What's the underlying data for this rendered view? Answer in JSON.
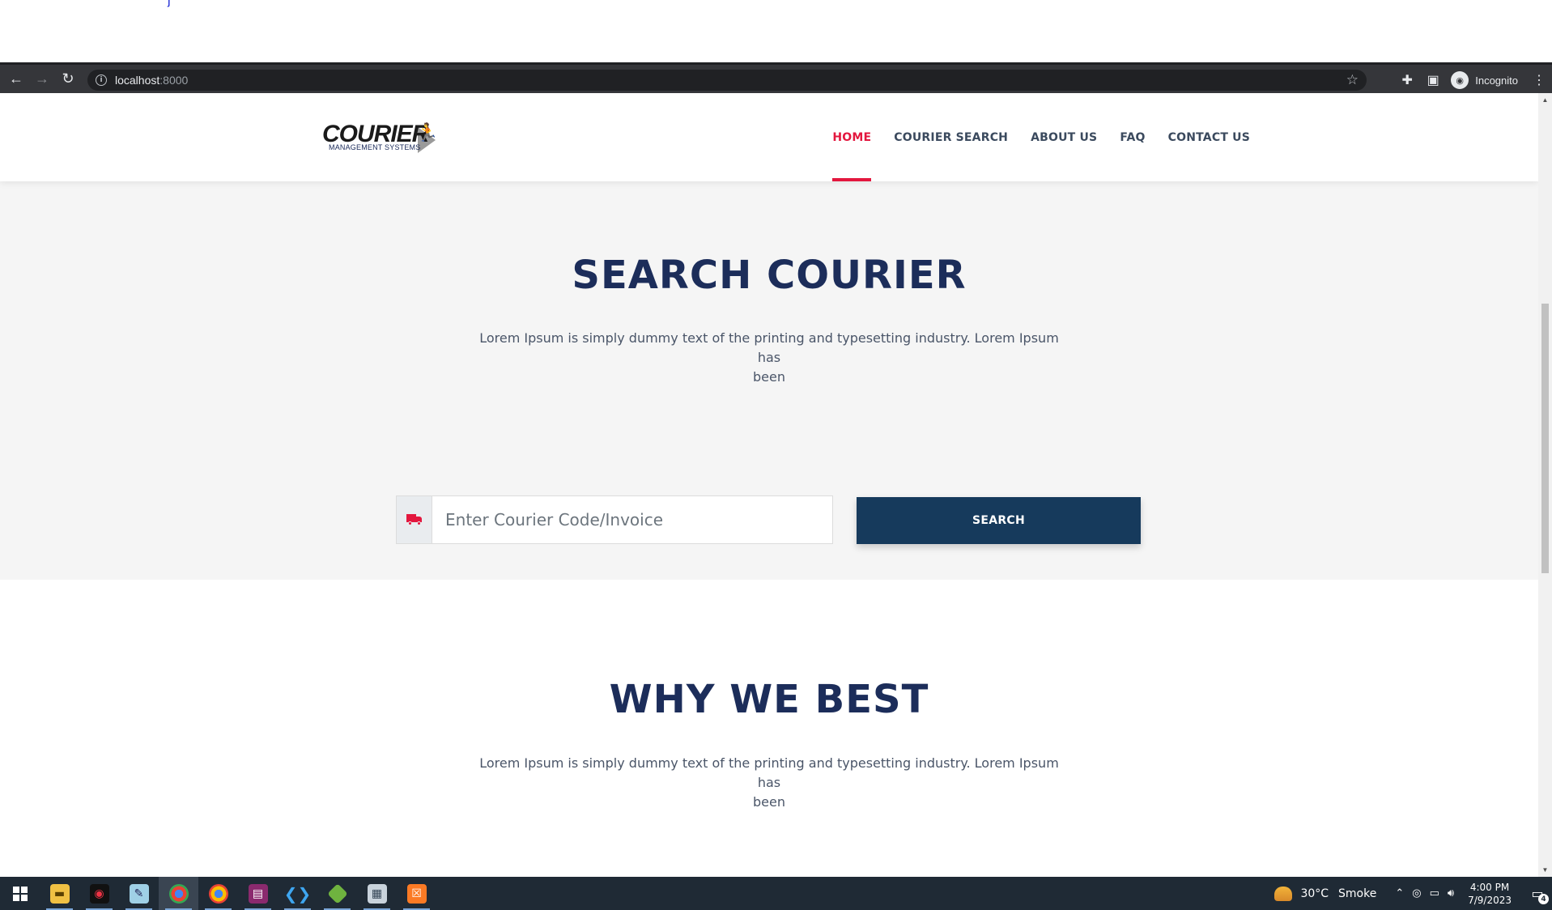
{
  "browser": {
    "url_host": "localhost",
    "url_port": ":8000",
    "profile_label": "Incognito",
    "icons": [
      "back-icon",
      "forward-icon",
      "reload-icon",
      "info-icon",
      "star-icon",
      "extensions-icon",
      "side-panel-icon",
      "incognito-icon",
      "menu-icon"
    ]
  },
  "site": {
    "logo_word": "COURIER",
    "logo_sub": "MANAGEMENT SYSTEMS",
    "nav": [
      {
        "label": "HOME",
        "active": true
      },
      {
        "label": "COURIER SEARCH",
        "active": false
      },
      {
        "label": "ABOUT US",
        "active": false
      },
      {
        "label": "FAQ",
        "active": false
      },
      {
        "label": "CONTACT US",
        "active": false
      }
    ]
  },
  "search_section": {
    "title": "SEARCH COURIER",
    "text_line1": "Lorem Ipsum is simply dummy text of the printing and typesetting industry. Lorem Ipsum has",
    "text_line2": "been",
    "input_placeholder": "Enter Courier Code/Invoice",
    "input_icon": "truck-icon",
    "button_label": "SEARCH"
  },
  "why_section": {
    "title": "WHY WE BEST",
    "text_line1": "Lorem Ipsum is simply dummy text of the printing and typesetting industry. Lorem Ipsum has",
    "text_line2": "been"
  },
  "colors": {
    "accent_red": "#e3173e",
    "navy_title": "#1c2d5a",
    "button_blue": "#163a5c",
    "section_bg": "#f5f5f5"
  },
  "taskbar": {
    "apps": [
      "start-icon",
      "file-explorer-icon",
      "media-app-icon",
      "notepad-icon",
      "chrome-icon",
      "chrome-incognito-icon",
      "winrar-icon",
      "vscode-icon",
      "git-icon",
      "network-app-icon",
      "xampp-icon"
    ],
    "weather_temp": "30°C",
    "weather_desc": "Smoke",
    "time": "4:00 PM",
    "date": "7/9/2023",
    "notification_count": "4"
  }
}
